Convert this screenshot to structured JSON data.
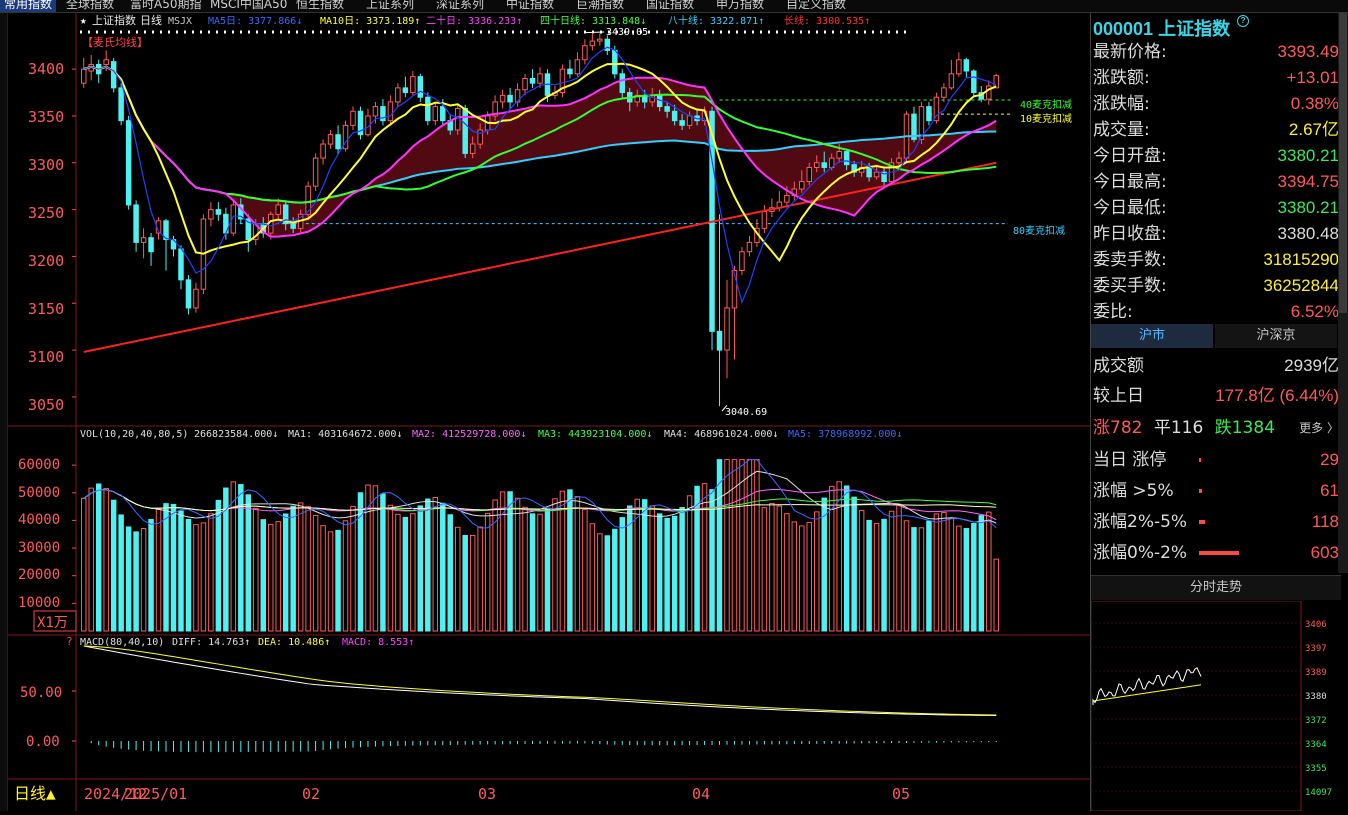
{
  "topbar": {
    "tabs": [
      "常用指数",
      "全球指数",
      "富时A50期指",
      "MSCI中国A50",
      "恒生指数",
      "上证系列",
      "深证系列",
      "中证指数",
      "巨潮指数",
      "国证指数",
      "申万指数",
      "自定义指数"
    ]
  },
  "chart_header": {
    "name": "上证指数",
    "period": "日线",
    "ma_label": "MSJX",
    "ma5": "MA5日: 3377.866↓",
    "ma10": "MA10日: 3373.189↑",
    "ma20": "二十日: 3336.233↑",
    "ma40": "四十日线: 3313.848↓",
    "ma80": "八十线: 3322.871↑",
    "ma_long": "长线: 3300.535↑",
    "indicator_tag": "【麦氏均线】",
    "high_mark": "3439.05",
    "low_mark": "3040.69",
    "ann_40": "40麦克扣减",
    "ann_10": "10麦克扣减",
    "ann_80": "80麦克扣减"
  },
  "price_axis": [
    "3400",
    "3350",
    "3300",
    "3250",
    "3200",
    "3150",
    "3100",
    "3050"
  ],
  "vol_header": {
    "label": "VOL(10,20,40,80,5)",
    "vol": "266823584.000↓",
    "ma1": "MA1: 403164672.000↓",
    "ma2": "MA2: 412529728.000↓",
    "ma3": "MA3: 443923104.000↓",
    "ma4": "MA4: 468961024.000↓",
    "ma5": "MA5: 378968992.000↓"
  },
  "vol_axis": [
    "60000",
    "50000",
    "40000",
    "30000",
    "20000",
    "10000"
  ],
  "vol_unit": "X1万",
  "macd_header": {
    "label": "MACD(80,40,10)",
    "diff": "DIFF: 14.763↑",
    "dea": "DEA: 10.486↑",
    "macd": "MACD: 8.553↑"
  },
  "macd_axis": [
    "50.00",
    "0.00"
  ],
  "bottom": {
    "period_label": "日线▲",
    "date_labels": [
      "2024/12",
      "2025/01",
      "02",
      "03",
      "04",
      "05"
    ]
  },
  "colors": {
    "up": "#ff5a5a",
    "down": "#4ef0f0",
    "ma5": "#2040ff",
    "ma10": "#ffff33",
    "ma20": "#ff33ff",
    "ma40": "#33ff33",
    "ma80": "#33d0ff",
    "long": "#ff2222"
  },
  "right_panel": {
    "code": "000001",
    "name": "上证指数",
    "rows": [
      {
        "label": "最新价格:",
        "value": "3393.49",
        "cls": "red"
      },
      {
        "label": "涨跌额:",
        "value": "+13.01",
        "cls": "red"
      },
      {
        "label": "涨跌幅:",
        "value": "0.38%",
        "cls": "red"
      },
      {
        "label": "成交量:",
        "value": "2.67亿",
        "cls": "yellow"
      },
      {
        "label": "今日开盘:",
        "value": "3380.21",
        "cls": "green"
      },
      {
        "label": "今日最高:",
        "value": "3394.75",
        "cls": "red"
      },
      {
        "label": "今日最低:",
        "value": "3380.21",
        "cls": "green"
      },
      {
        "label": "昨日收盘:",
        "value": "3380.48",
        "cls": "white"
      },
      {
        "label": "委卖手数:",
        "value": "31815290",
        "cls": "yellow"
      },
      {
        "label": "委买手数:",
        "value": "36252844",
        "cls": "yellow"
      },
      {
        "label": "委比:",
        "value": "6.52%",
        "cls": "red"
      }
    ],
    "tab_sh": "沪市",
    "tab_shsz": "沪深京",
    "turnover_label": "成交额",
    "turnover_value": "2939亿",
    "prev_label": "较上日",
    "prev_value": "177.8亿 (6.44%)",
    "up_count": "涨782",
    "flat_count": "平116",
    "down_count": "跌1384",
    "more": "更多 〉",
    "stats": [
      {
        "label": "当日 涨停",
        "value": "29",
        "bar": 2
      },
      {
        "label": "涨幅 >5%",
        "value": "61",
        "bar": 3
      },
      {
        "label": "涨幅2%-5%",
        "value": "118",
        "bar": 6
      },
      {
        "label": "涨幅0%-2%",
        "value": "603",
        "bar": 40
      }
    ],
    "mini_title": "分时走势",
    "mini_axis": [
      "3406",
      "3397",
      "3389",
      "3380",
      "3372",
      "3364",
      "3355",
      "14097"
    ]
  },
  "chart_data": {
    "type": "candlestick",
    "ylim": [
      3020,
      3445
    ],
    "high": 3439.05,
    "low": 3040.69,
    "candles": [
      [
        3385,
        3400,
        3412,
        3380
      ],
      [
        3398,
        3405,
        3415,
        3388
      ],
      [
        3405,
        3395,
        3410,
        3385
      ],
      [
        3405,
        3410,
        3420,
        3398
      ],
      [
        3408,
        3380,
        3412,
        3375
      ],
      [
        3380,
        3345,
        3385,
        3340
      ],
      [
        3345,
        3255,
        3350,
        3250
      ],
      [
        3255,
        3215,
        3260,
        3205
      ],
      [
        3215,
        3220,
        3230,
        3198
      ],
      [
        3220,
        3205,
        3225,
        3190
      ],
      [
        3225,
        3238,
        3242,
        3218
      ],
      [
        3238,
        3218,
        3240,
        3185
      ],
      [
        3218,
        3208,
        3222,
        3200
      ],
      [
        3208,
        3175,
        3212,
        3165
      ],
      [
        3175,
        3145,
        3180,
        3138
      ],
      [
        3145,
        3165,
        3172,
        3140
      ],
      [
        3165,
        3240,
        3245,
        3160
      ],
      [
        3240,
        3250,
        3258,
        3232
      ],
      [
        3250,
        3245,
        3258,
        3238
      ],
      [
        3245,
        3225,
        3252,
        3218
      ],
      [
        3225,
        3255,
        3260,
        3222
      ],
      [
        3255,
        3240,
        3262,
        3235
      ],
      [
        3240,
        3218,
        3245,
        3205
      ],
      [
        3218,
        3235,
        3240,
        3212
      ],
      [
        3235,
        3225,
        3242,
        3220
      ],
      [
        3225,
        3245,
        3248,
        3218
      ],
      [
        3245,
        3255,
        3262,
        3240
      ],
      [
        3255,
        3235,
        3260,
        3228
      ],
      [
        3235,
        3230,
        3242,
        3225
      ],
      [
        3230,
        3245,
        3250,
        3226
      ],
      [
        3245,
        3275,
        3280,
        3240
      ],
      [
        3275,
        3305,
        3310,
        3270
      ],
      [
        3305,
        3320,
        3325,
        3298
      ],
      [
        3320,
        3330,
        3335,
        3315
      ],
      [
        3330,
        3315,
        3340,
        3310
      ],
      [
        3315,
        3340,
        3345,
        3312
      ],
      [
        3340,
        3355,
        3360,
        3335
      ],
      [
        3355,
        3330,
        3360,
        3325
      ],
      [
        3330,
        3350,
        3358,
        3328
      ],
      [
        3350,
        3360,
        3365,
        3342
      ],
      [
        3360,
        3345,
        3368,
        3340
      ],
      [
        3345,
        3365,
        3372,
        3342
      ],
      [
        3365,
        3380,
        3385,
        3360
      ],
      [
        3380,
        3375,
        3392,
        3370
      ],
      [
        3375,
        3392,
        3398,
        3372
      ],
      [
        3392,
        3370,
        3395,
        3365
      ],
      [
        3370,
        3345,
        3375,
        3340
      ],
      [
        3345,
        3360,
        3365,
        3340
      ],
      [
        3360,
        3345,
        3368,
        3340
      ],
      [
        3345,
        3335,
        3352,
        3330
      ],
      [
        3335,
        3358,
        3362,
        3330
      ],
      [
        3358,
        3310,
        3362,
        3305
      ],
      [
        3310,
        3320,
        3328,
        3305
      ],
      [
        3320,
        3335,
        3342,
        3315
      ],
      [
        3335,
        3350,
        3355,
        3330
      ],
      [
        3350,
        3365,
        3372,
        3345
      ],
      [
        3365,
        3372,
        3378,
        3358
      ],
      [
        3372,
        3365,
        3380,
        3358
      ],
      [
        3365,
        3378,
        3385,
        3360
      ],
      [
        3378,
        3390,
        3395,
        3372
      ],
      [
        3390,
        3385,
        3400,
        3380
      ],
      [
        3385,
        3395,
        3402,
        3380
      ],
      [
        3395,
        3372,
        3400,
        3365
      ],
      [
        3372,
        3375,
        3382,
        3368
      ],
      [
        3375,
        3400,
        3405,
        3370
      ],
      [
        3400,
        3395,
        3410,
        3390
      ],
      [
        3395,
        3410,
        3418,
        3392
      ],
      [
        3410,
        3425,
        3432,
        3405
      ],
      [
        3425,
        3430,
        3439,
        3420
      ],
      [
        3430,
        3432,
        3438,
        3425
      ],
      [
        3432,
        3420,
        3436,
        3415
      ],
      [
        3420,
        3395,
        3425,
        3390
      ],
      [
        3395,
        3375,
        3400,
        3368
      ],
      [
        3375,
        3365,
        3380,
        3355
      ],
      [
        3365,
        3372,
        3378,
        3360
      ],
      [
        3372,
        3365,
        3378,
        3358
      ],
      [
        3365,
        3372,
        3380,
        3360
      ],
      [
        3372,
        3360,
        3378,
        3355
      ],
      [
        3360,
        3355,
        3365,
        3348
      ],
      [
        3355,
        3345,
        3362,
        3340
      ],
      [
        3345,
        3340,
        3352,
        3335
      ],
      [
        3340,
        3350,
        3355,
        3336
      ],
      [
        3350,
        3345,
        3358,
        3340
      ],
      [
        3345,
        3355,
        3360,
        3340
      ],
      [
        3355,
        3120,
        3360,
        3100
      ],
      [
        3120,
        3100,
        3245,
        3040
      ],
      [
        3100,
        3145,
        3175,
        3070
      ],
      [
        3145,
        3185,
        3190,
        3090
      ],
      [
        3185,
        3205,
        3210,
        3180
      ],
      [
        3205,
        3215,
        3222,
        3200
      ],
      [
        3215,
        3230,
        3240,
        3210
      ],
      [
        3230,
        3248,
        3255,
        3225
      ],
      [
        3248,
        3252,
        3262,
        3242
      ],
      [
        3252,
        3258,
        3270,
        3248
      ],
      [
        3258,
        3265,
        3275,
        3252
      ],
      [
        3265,
        3272,
        3280,
        3260
      ],
      [
        3272,
        3280,
        3292,
        3268
      ],
      [
        3280,
        3295,
        3300,
        3276
      ],
      [
        3295,
        3300,
        3308,
        3290
      ],
      [
        3300,
        3295,
        3312,
        3290
      ],
      [
        3295,
        3305,
        3310,
        3292
      ],
      [
        3305,
        3312,
        3320,
        3300
      ],
      [
        3312,
        3298,
        3315,
        3292
      ],
      [
        3298,
        3290,
        3302,
        3285
      ],
      [
        3290,
        3295,
        3302,
        3285
      ],
      [
        3295,
        3285,
        3300,
        3280
      ],
      [
        3285,
        3290,
        3296,
        3282
      ],
      [
        3290,
        3280,
        3295,
        3276
      ],
      [
        3280,
        3300,
        3305,
        3278
      ],
      [
        3300,
        3305,
        3312,
        3295
      ],
      [
        3305,
        3352,
        3355,
        3300
      ],
      [
        3352,
        3325,
        3360,
        3322
      ],
      [
        3325,
        3360,
        3365,
        3320
      ],
      [
        3360,
        3345,
        3365,
        3340
      ],
      [
        3345,
        3370,
        3375,
        3342
      ],
      [
        3370,
        3380,
        3385,
        3365
      ],
      [
        3380,
        3395,
        3410,
        3378
      ],
      [
        3395,
        3410,
        3418,
        3392
      ],
      [
        3410,
        3398,
        3412,
        3390
      ],
      [
        3398,
        3375,
        3400,
        3370
      ],
      [
        3375,
        3368,
        3382,
        3365
      ],
      [
        3368,
        3382,
        3388,
        3362
      ],
      [
        3380,
        3393,
        3395,
        3380
      ]
    ]
  }
}
